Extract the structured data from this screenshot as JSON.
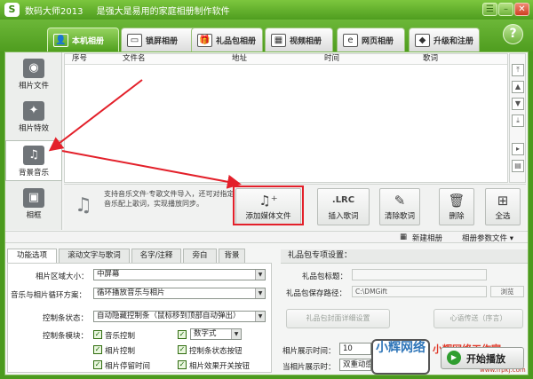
{
  "app": {
    "title": "数码大师2013",
    "subtitle": "是强大是易用的家庭相册制作软件",
    "logo": "S"
  },
  "tabs": [
    {
      "label": "本机相册",
      "icon": "user-icon"
    },
    {
      "label": "锁屏相册",
      "icon": "monitor-icon"
    },
    {
      "label": "礼品包相册",
      "icon": "gift-icon"
    },
    {
      "label": "视频相册",
      "icon": "film-icon"
    },
    {
      "label": "网页相册",
      "icon": "browser-icon"
    },
    {
      "label": "升级和注册",
      "icon": "cube-icon"
    }
  ],
  "sidebar": [
    {
      "label": "相片文件",
      "icon": "camera-icon"
    },
    {
      "label": "相片特效",
      "icon": "sparkle-icon"
    },
    {
      "label": "背景音乐",
      "icon": "music-icon"
    },
    {
      "label": "相框",
      "icon": "frame-icon"
    }
  ],
  "table": {
    "columns": [
      "序号",
      "文件名",
      "地址",
      "时间",
      "歌词"
    ]
  },
  "tip": "支持音乐文件·专歌文件导入，还可对指定音乐配上歌词，实现播放同步。",
  "buttons": {
    "add_media": "添加媒体文件",
    "insert_lyrics": "插入歌词",
    "clear_lyrics": "清除歌词",
    "delete": "删除",
    "select_all": "全选",
    "lrc": ".LRC"
  },
  "toolbar2": {
    "new_album": "新建相册",
    "params": "相册参数文件 ▾"
  },
  "subtabs": [
    "功能选项",
    "滚动文字与歌词",
    "名字/注释",
    "旁白",
    "背景"
  ],
  "options": {
    "size_label": "相片区域大小：",
    "size_value": "中屏幕",
    "loop_label": "音乐与相片循环方案：",
    "loop_value": "循环播放音乐与相片",
    "ctrl_label": "控制条状态：",
    "ctrl_value": "自动隐藏控制条（鼠标移到顶部自动弹出）",
    "module_label": "控制条模块：",
    "checks": [
      "音乐控制",
      "数字式",
      "相片控制",
      "控制条状态按钮",
      "相片停留时间",
      "相片效果开关按钮"
    ]
  },
  "gift": {
    "header": "礼品包专项设置：",
    "title_label": "礼品包标题：",
    "path_label": "礼品包保存路径：",
    "path_value": "C:\\DMGift",
    "browse": "浏览",
    "cover_btn": "礼品包封面详细设置",
    "card_btn": "心语传送（序言）"
  },
  "bottom": {
    "show_time_label": "相片展示时间：",
    "show_time_value": "10",
    "current_label": "当相片展示时：",
    "current_value": "双重动感"
  },
  "watermark": {
    "logo": "小辉网络",
    "text": "小辉网络工作室",
    "url": "www.frpkj.com"
  },
  "start": "开始播放"
}
